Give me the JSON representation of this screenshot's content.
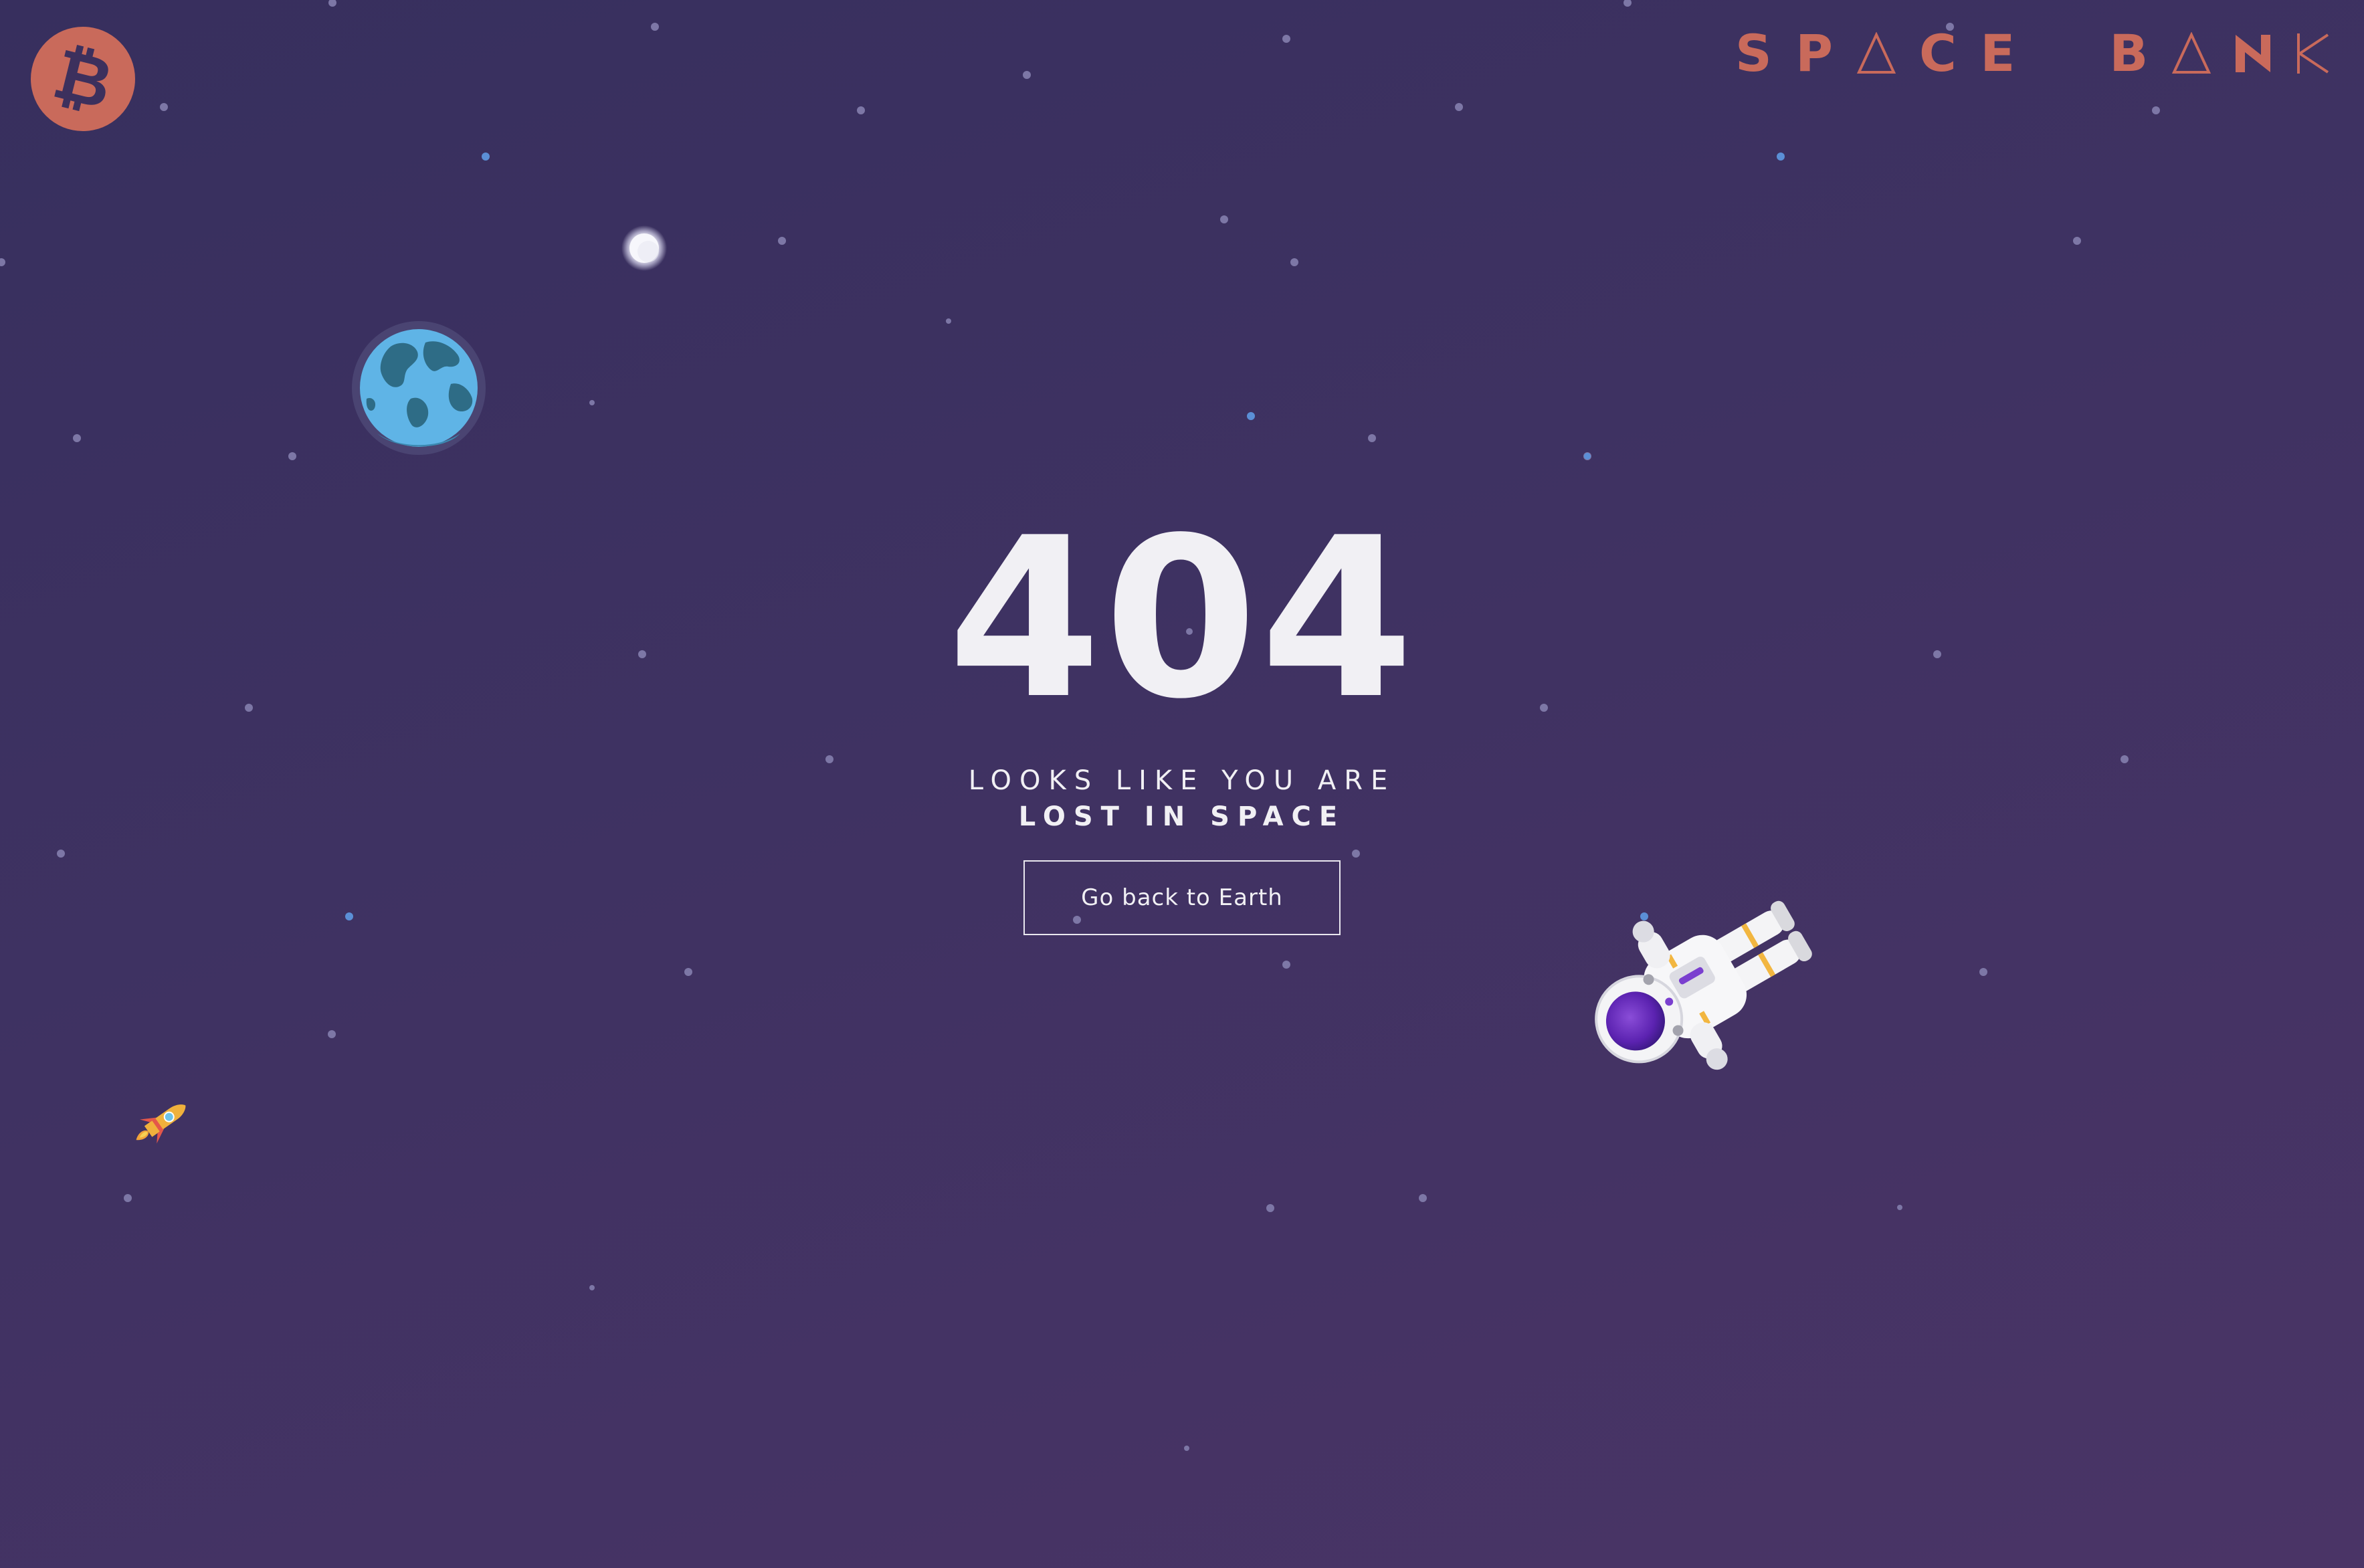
{
  "logo": {
    "glyph": "₿",
    "icon": "bitcoin-icon"
  },
  "brand": {
    "letters": [
      "S",
      "P",
      "A",
      "C",
      "E",
      "B",
      "A",
      "N",
      "K"
    ],
    "color": "#c96a5b"
  },
  "error": {
    "code": "404",
    "line1": "LOOKS LIKE YOU ARE",
    "line2": "LOST IN SPACE"
  },
  "cta": {
    "label": "Go back to Earth"
  },
  "colors": {
    "background_top": "#372f5e",
    "background_bottom": "#4a3466",
    "accent": "#c96a5b",
    "text": "#f1f0f4"
  }
}
